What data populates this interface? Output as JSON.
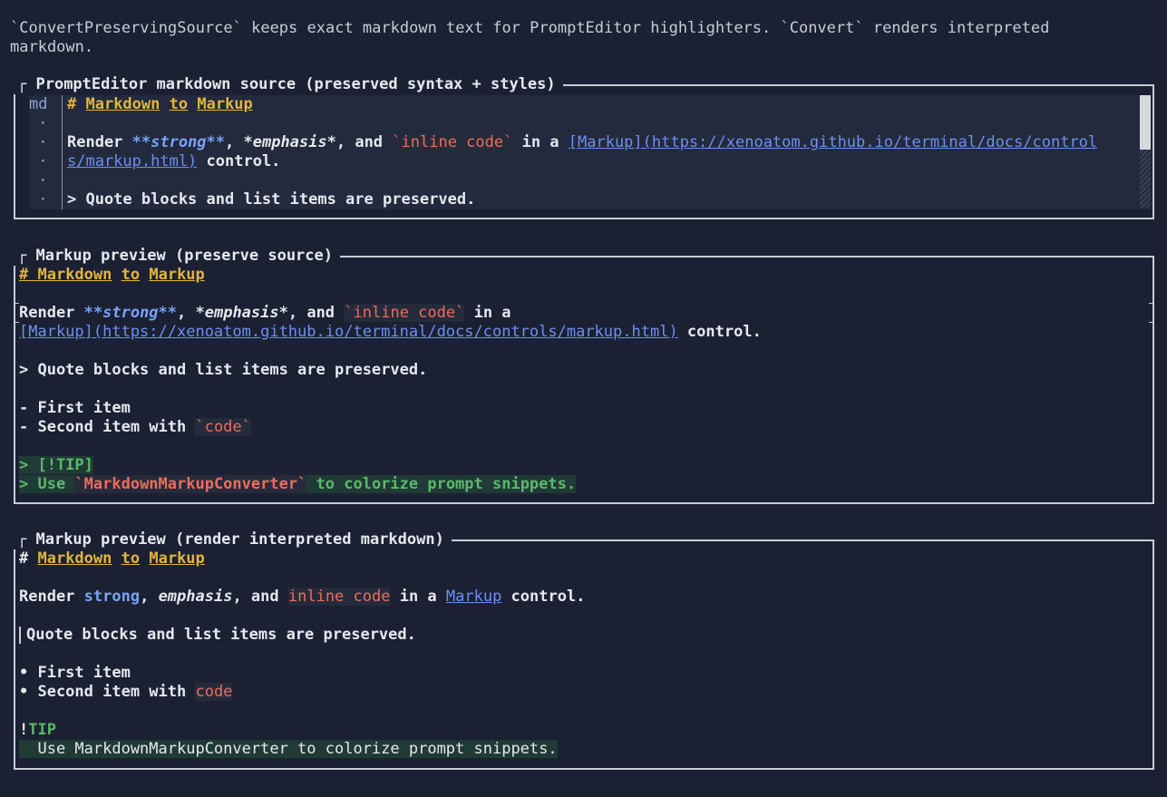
{
  "description": {
    "line1": "`ConvertPreservingSource` keeps exact markdown text for PromptEditor highlighters. `Convert` renders interpreted",
    "line2": "markdown."
  },
  "source_panel": {
    "title": "PromptEditor markdown source (preserved syntax + styles)",
    "gutter": [
      "md",
      " ·",
      " ·",
      " ·",
      " ·",
      " ·"
    ],
    "lines": {
      "l1_hash": "# ",
      "l1_w1": "Markdown",
      "l1_w2": "to",
      "l1_w3": "Markup",
      "l3_a": "Render ",
      "l3_strong": "**strong**",
      "l3_b": ", ",
      "l3_em": "*emphasis*",
      "l3_c": ", and ",
      "l3_code": "`inline code`",
      "l3_d": " in a ",
      "l3_link1": "[Markup](https://xenoatom.github.io/terminal/docs/control",
      "l4_link2": "s/markup.html)",
      "l4_tail": " control.",
      "l6": "> Quote blocks and list items are preserved."
    }
  },
  "preserve_panel": {
    "title": "Markup preview (preserve source)",
    "h_hash": "# ",
    "h_w1": "Markdown",
    "h_w2": "to",
    "h_w3": "Markup",
    "p_a": "Render ",
    "p_strong": "**strong**",
    "p_b": ", ",
    "p_em": "*emphasis*",
    "p_c": ", and ",
    "p_code": "`inline code`",
    "p_d": " in a",
    "p_link": "[Markup](https://xenoatom.github.io/terminal/docs/controls/markup.html)",
    "p_tail": " control.",
    "quote": "> Quote blocks and list items are preserved.",
    "item1": "- First item",
    "item2_a": "- Second item with ",
    "item2_code": "`code`",
    "tip1": "> [!TIP]",
    "tip2_a": "> Use ",
    "tip2_code": "`MarkdownMarkupConverter`",
    "tip2_b": " to colorize prompt snippets."
  },
  "render_panel": {
    "title": "Markup preview (render interpreted markdown)",
    "h_hash": "# ",
    "h_w1": "Markdown",
    "h_w2": "to",
    "h_w3": "Markup",
    "p_a": "Render ",
    "p_strong": "strong",
    "p_b": ", ",
    "p_em": "emphasis",
    "p_c": ", and ",
    "p_code": "inline code",
    "p_d": " in a ",
    "p_link": "Markup",
    "p_tail": " control.",
    "quote": "Quote blocks and list items are preserved.",
    "item1": "• First item",
    "item2_a": "• Second item with ",
    "item2_code": "code",
    "tip_bang": "!",
    "tip_word": "TIP",
    "tip_body": "  Use MarkdownMarkupConverter to colorize prompt snippets."
  }
}
